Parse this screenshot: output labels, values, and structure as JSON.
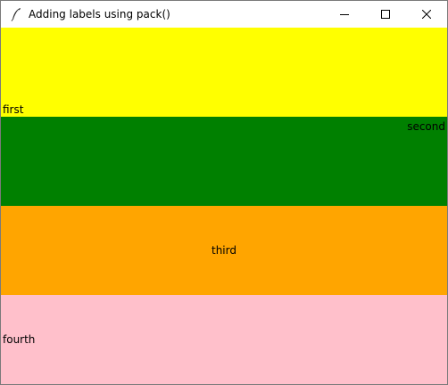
{
  "window": {
    "title": "Adding labels using pack()",
    "icon": "feather-icon"
  },
  "controls": {
    "minimize_icon": "minimize-icon",
    "maximize_icon": "maximize-icon",
    "close_icon": "close-icon"
  },
  "labels": [
    {
      "text": "first",
      "bg": "#ffff00",
      "anchor": "bottom-left"
    },
    {
      "text": "second",
      "bg": "#008000",
      "anchor": "top-right"
    },
    {
      "text": "third",
      "bg": "#ffa500",
      "anchor": "center"
    },
    {
      "text": "fourth",
      "bg": "#ffc0cb",
      "anchor": "left"
    }
  ]
}
